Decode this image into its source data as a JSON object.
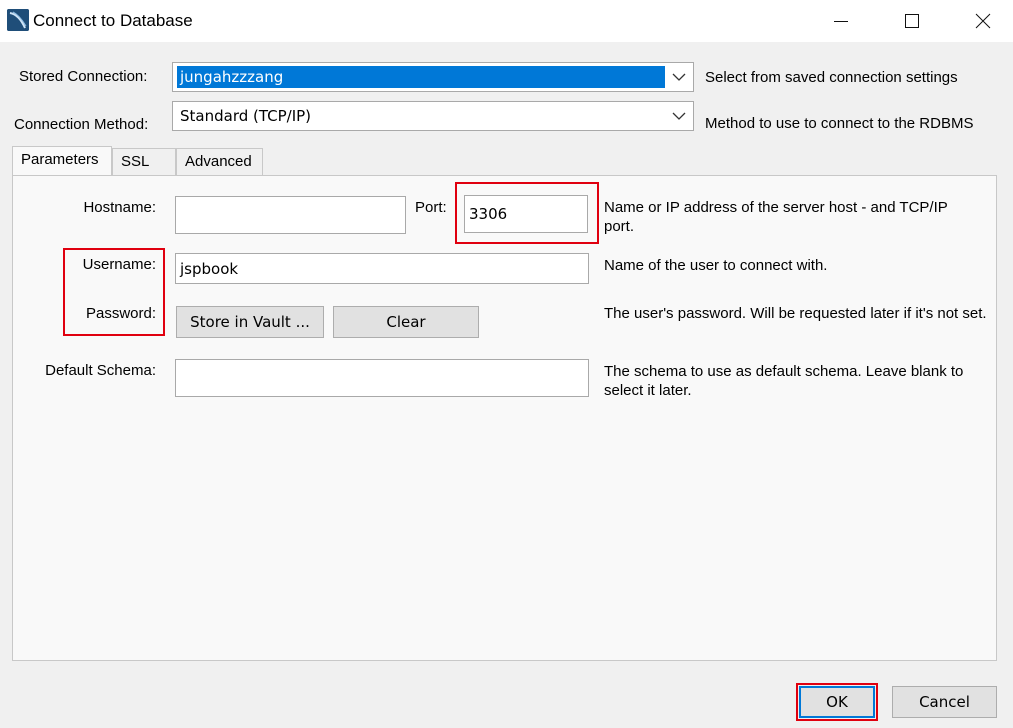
{
  "window": {
    "title": "Connect to Database",
    "controls": {
      "minimize": "—",
      "maximize": "☐",
      "close": "✕"
    }
  },
  "stored_connection": {
    "label": "Stored Connection:",
    "value": "jungahzzzang",
    "description": "Select from saved connection settings"
  },
  "connection_method": {
    "label": "Connection Method:",
    "value": "Standard (TCP/IP)",
    "description": "Method to use to connect to the RDBMS"
  },
  "tabs": [
    {
      "label": "Parameters",
      "active": true
    },
    {
      "label": "SSL",
      "active": false
    },
    {
      "label": "Advanced",
      "active": false
    }
  ],
  "parameters": {
    "hostname": {
      "label": "Hostname:",
      "value": ""
    },
    "port": {
      "label": "Port:",
      "value": "3306"
    },
    "host_description": "Name or IP address of the server host - and TCP/IP port.",
    "username": {
      "label": "Username:",
      "value": "jspbook",
      "description": "Name of the user to connect with."
    },
    "password": {
      "label": "Password:",
      "store_button": "Store in Vault ...",
      "clear_button": "Clear",
      "description": "The user's password. Will be requested later if it's not set."
    },
    "default_schema": {
      "label": "Default Schema:",
      "value": "",
      "description": "The schema to use as default schema. Leave blank to select it later."
    }
  },
  "footer": {
    "ok": "OK",
    "cancel": "Cancel"
  },
  "colors": {
    "highlight_box": "#e0000f",
    "selection": "#0078d7"
  }
}
